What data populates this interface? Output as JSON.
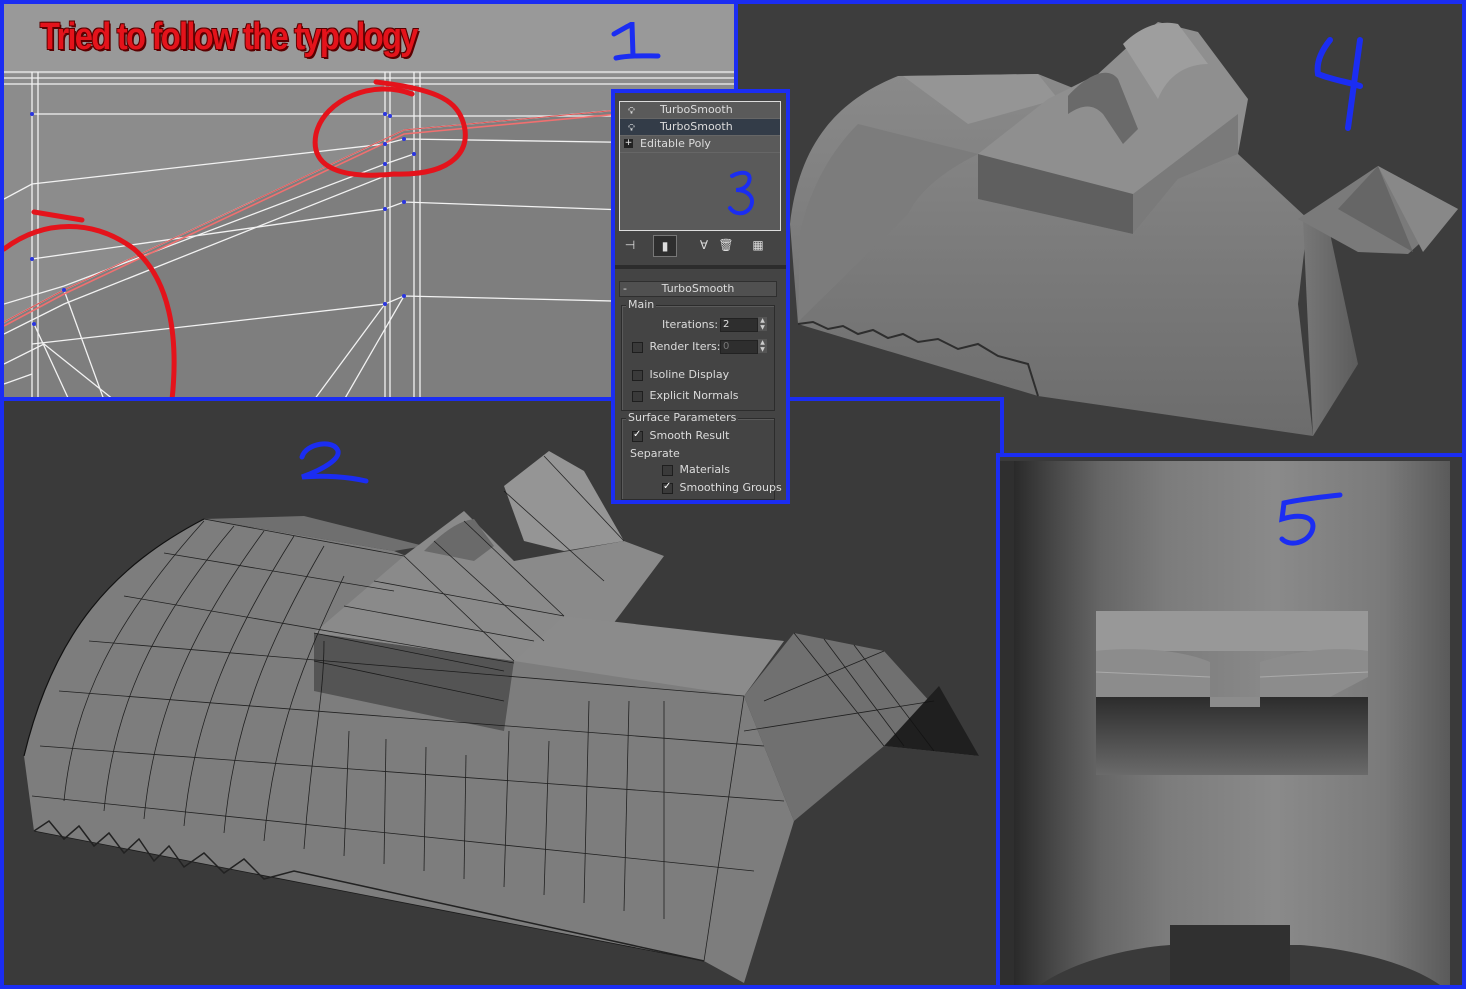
{
  "annotation": {
    "title": "Tried to follow the typology",
    "label_1": "1",
    "label_2": "2",
    "label_3": "3",
    "label_4": "4",
    "label_5": "5"
  },
  "colors": {
    "annotation_red": "#e4131b",
    "annotation_blue": "#1b2df2",
    "viewport_bg": "#3a3a3a",
    "selected_edge": "#f07070"
  },
  "modifier_stack": {
    "items": [
      {
        "label": "TurboSmooth",
        "icon": "lightbulb-icon",
        "selected": false
      },
      {
        "label": "TurboSmooth",
        "icon": "lightbulb-icon",
        "selected": true
      },
      {
        "label": "Editable Poly",
        "icon": "plus-expand-icon",
        "selected": false
      }
    ]
  },
  "stack_toolbar": {
    "icons": [
      "pin-stack-icon",
      "show-end-result-icon",
      "make-unique-icon",
      "remove-modifier-icon",
      "configure-modifier-sets-icon"
    ]
  },
  "turbosmooth": {
    "rollout_title": "TurboSmooth",
    "collapse_symbol": "-",
    "main_group": "Main",
    "iterations_label": "Iterations:",
    "iterations_value": "2",
    "render_iters_label": "Render Iters:",
    "render_iters_value": "0",
    "render_iters_checked": false,
    "isoline_label": "Isoline Display",
    "isoline_checked": false,
    "explicit_normals_label": "Explicit Normals",
    "explicit_normals_checked": false,
    "surface_group": "Surface Parameters",
    "smooth_result_label": "Smooth Result",
    "smooth_result_checked": true,
    "separate_label": "Separate",
    "materials_label": "Materials",
    "materials_checked": false,
    "smoothing_groups_label": "Smoothing Groups",
    "smoothing_groups_checked": true
  }
}
